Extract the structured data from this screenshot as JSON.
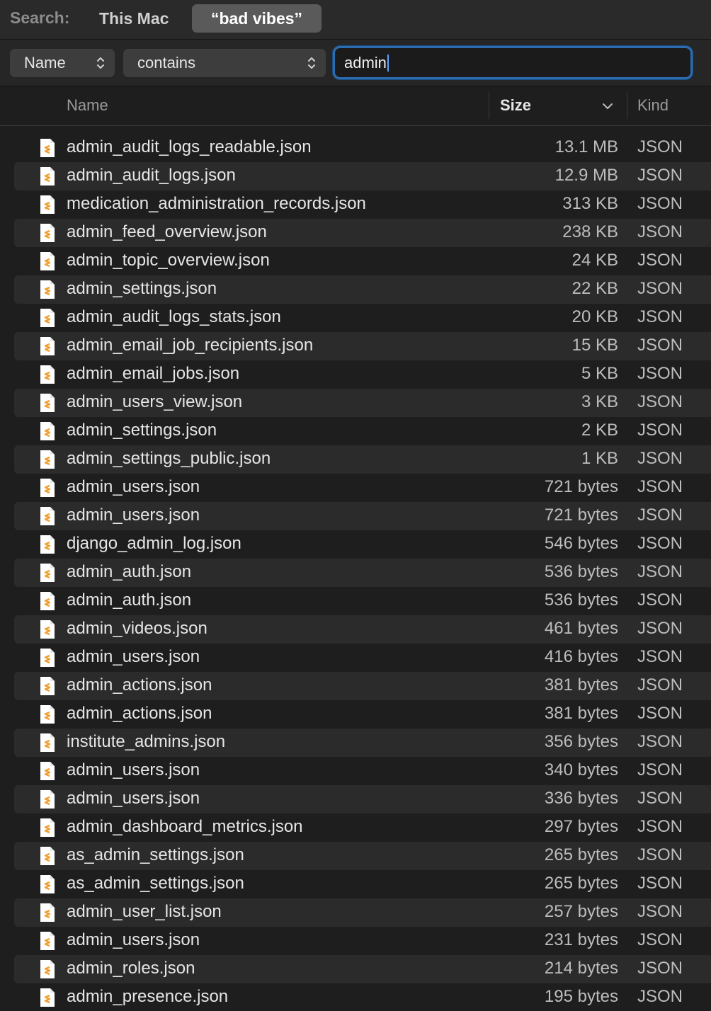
{
  "scope": {
    "label": "Search:",
    "this_mac": "This Mac",
    "current_folder": "“bad vibes”"
  },
  "criteria": {
    "attribute": "Name",
    "operator": "contains",
    "query": "admin"
  },
  "columns": {
    "name": "Name",
    "size": "Size",
    "kind": "Kind"
  },
  "colors": {
    "accent": "#2b6cb0",
    "file_icon": "#f0a030"
  },
  "files": [
    {
      "name": "admin_audit_logs_readable.json",
      "size": "13.1 MB",
      "kind": "JSON"
    },
    {
      "name": "admin_audit_logs.json",
      "size": "12.9 MB",
      "kind": "JSON"
    },
    {
      "name": "medication_administration_records.json",
      "size": "313 KB",
      "kind": "JSON"
    },
    {
      "name": "admin_feed_overview.json",
      "size": "238 KB",
      "kind": "JSON"
    },
    {
      "name": "admin_topic_overview.json",
      "size": "24 KB",
      "kind": "JSON"
    },
    {
      "name": "admin_settings.json",
      "size": "22 KB",
      "kind": "JSON"
    },
    {
      "name": "admin_audit_logs_stats.json",
      "size": "20 KB",
      "kind": "JSON"
    },
    {
      "name": "admin_email_job_recipients.json",
      "size": "15 KB",
      "kind": "JSON"
    },
    {
      "name": "admin_email_jobs.json",
      "size": "5 KB",
      "kind": "JSON"
    },
    {
      "name": "admin_users_view.json",
      "size": "3 KB",
      "kind": "JSON"
    },
    {
      "name": "admin_settings.json",
      "size": "2 KB",
      "kind": "JSON"
    },
    {
      "name": "admin_settings_public.json",
      "size": "1 KB",
      "kind": "JSON"
    },
    {
      "name": "admin_users.json",
      "size": "721 bytes",
      "kind": "JSON"
    },
    {
      "name": "admin_users.json",
      "size": "721 bytes",
      "kind": "JSON"
    },
    {
      "name": "django_admin_log.json",
      "size": "546 bytes",
      "kind": "JSON"
    },
    {
      "name": "admin_auth.json",
      "size": "536 bytes",
      "kind": "JSON"
    },
    {
      "name": "admin_auth.json",
      "size": "536 bytes",
      "kind": "JSON"
    },
    {
      "name": "admin_videos.json",
      "size": "461 bytes",
      "kind": "JSON"
    },
    {
      "name": "admin_users.json",
      "size": "416 bytes",
      "kind": "JSON"
    },
    {
      "name": "admin_actions.json",
      "size": "381 bytes",
      "kind": "JSON"
    },
    {
      "name": "admin_actions.json",
      "size": "381 bytes",
      "kind": "JSON"
    },
    {
      "name": "institute_admins.json",
      "size": "356 bytes",
      "kind": "JSON"
    },
    {
      "name": "admin_users.json",
      "size": "340 bytes",
      "kind": "JSON"
    },
    {
      "name": "admin_users.json",
      "size": "336 bytes",
      "kind": "JSON"
    },
    {
      "name": "admin_dashboard_metrics.json",
      "size": "297 bytes",
      "kind": "JSON"
    },
    {
      "name": "as_admin_settings.json",
      "size": "265 bytes",
      "kind": "JSON"
    },
    {
      "name": "as_admin_settings.json",
      "size": "265 bytes",
      "kind": "JSON"
    },
    {
      "name": "admin_user_list.json",
      "size": "257 bytes",
      "kind": "JSON"
    },
    {
      "name": "admin_users.json",
      "size": "231 bytes",
      "kind": "JSON"
    },
    {
      "name": "admin_roles.json",
      "size": "214 bytes",
      "kind": "JSON"
    },
    {
      "name": "admin_presence.json",
      "size": "195 bytes",
      "kind": "JSON"
    }
  ]
}
